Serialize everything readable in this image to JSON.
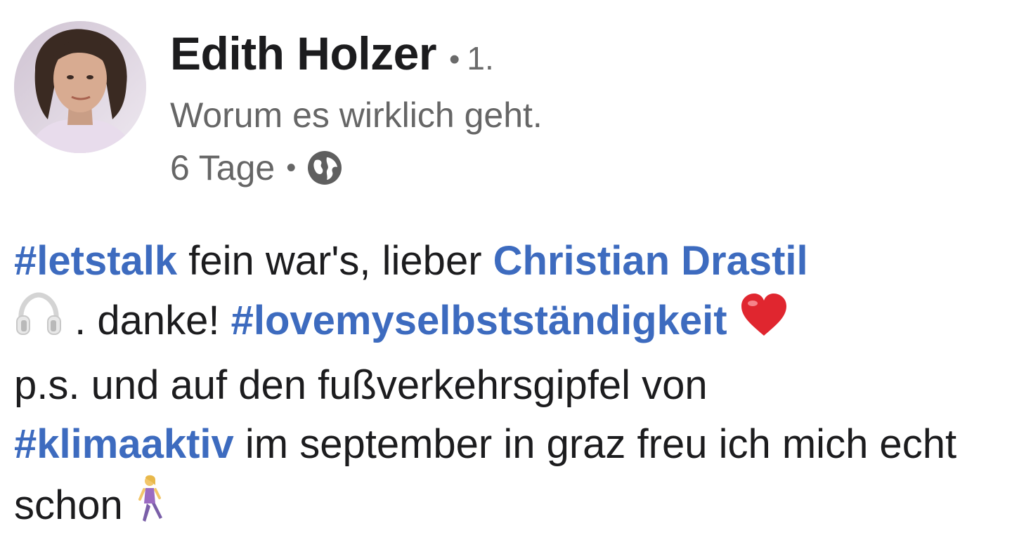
{
  "post": {
    "author": {
      "name": "Edith Holzer",
      "separator": "•",
      "connection_degree": "1.",
      "headline": "Worum es wirklich geht."
    },
    "meta": {
      "time": "6 Tage",
      "separator": "•",
      "visibility_icon": "globe-icon"
    },
    "content": {
      "hashtag_1": "#letstalk",
      "text_1": " fein war's, lieber ",
      "mention_1": "Christian Drastil",
      "emoji_1": "headphones-emoji",
      "text_2": " . danke! ",
      "hashtag_2": "#lovemyselbstständigkeit",
      "emoji_2": "red-heart-emoji",
      "text_3": "p.s. und auf den fußverkehrsgipfel von ",
      "hashtag_3": "#klimaaktiv",
      "text_4": " im september in graz freu ich mich echt schon ",
      "emoji_3": "woman-walking-emoji"
    },
    "colors": {
      "link": "#3d6bbf",
      "secondary_text": "#666666",
      "primary_text": "#1c1c1e"
    }
  }
}
